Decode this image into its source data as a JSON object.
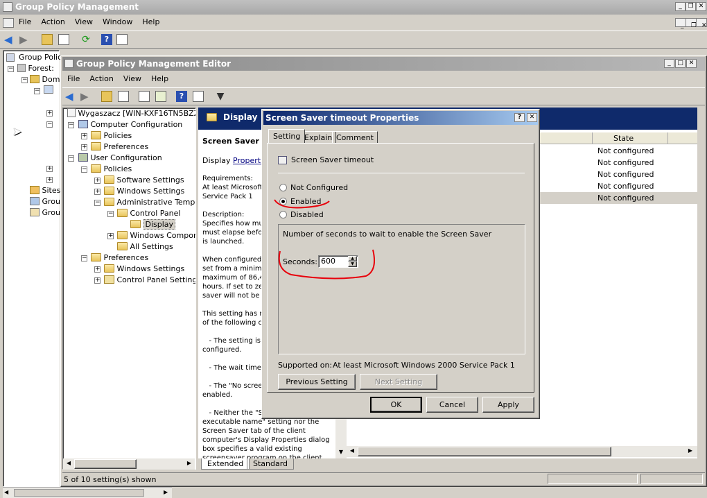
{
  "outer_window": {
    "title": "Group Policy Management",
    "menu": [
      "File",
      "Action",
      "View",
      "Window",
      "Help"
    ],
    "tree": [
      "Group Polic",
      "Forest:",
      "Dom",
      "Sites",
      "Grou",
      "Grou"
    ]
  },
  "editor": {
    "title": "Group Policy Management Editor",
    "menu": [
      "File",
      "Action",
      "View",
      "Help"
    ],
    "tree": {
      "root": "Wygaszacz [WIN-KXF16TN5BZZ.cc",
      "computer_configuration": "Computer Configuration",
      "policies": "Policies",
      "preferences": "Preferences",
      "user_configuration": "User Configuration",
      "user_policies": "Policies",
      "software_settings": "Software Settings",
      "windows_settings": "Windows Settings",
      "administrative_templates": "Administrative Templat",
      "control_panel": "Control Panel",
      "display": "Display",
      "windows_components": "Windows Compone",
      "all_settings": "All Settings",
      "user_preferences": "Preferences",
      "pref_windows_settings": "Windows Settings",
      "control_panel_settings": "Control Panel Settings"
    },
    "header": "Display",
    "desc": {
      "title": "Screen Saver t",
      "display_prefix": "Display",
      "properties_link": "Properties",
      "body_lines": [
        "Requirements:",
        "At least Microsoft",
        "Service Pack 1",
        "",
        "Description:",
        "Specifies how muc",
        "must elapse befor",
        "is launched.",
        "",
        "When configured,",
        "set from a minimu",
        "maximum of 86,40",
        "hours. If set to ze",
        "saver will not be s",
        "",
        "This setting has n",
        "of the following ci",
        "",
        "   - The setting is",
        "configured.",
        "",
        "   - The wait time",
        "",
        "   - The \"No scree",
        "enabled.",
        "",
        "   - Neither the \"S",
        "executable name\" setting nor the",
        "Screen Saver tab of the client",
        "computer's Display Properties dialog",
        "box specifies a valid existing",
        "screensaver program on the client"
      ]
    },
    "list": {
      "state_header": "State",
      "rows": [
        "Not configured",
        "Not configured",
        "Not configured",
        "Not configured",
        "Not configured"
      ]
    },
    "tabs": [
      "Extended",
      "Standard"
    ],
    "status": "5 of 10 setting(s) shown"
  },
  "dialog": {
    "title": "Screen Saver timeout Properties",
    "help_btn": "?",
    "close_btn": "✕",
    "tabs": [
      "Setting",
      "Explain",
      "Comment"
    ],
    "policy_name": "Screen Saver timeout",
    "options": [
      "Not Configured",
      "Enabled",
      "Disabled"
    ],
    "selected": "Enabled",
    "options_caption": "Number of seconds to wait to enable the Screen Saver",
    "seconds_label": "Seconds:",
    "seconds_value": "600",
    "supported_label": "Supported on:",
    "supported_value": "At least Microsoft Windows 2000 Service Pack 1",
    "previous_setting": "Previous Setting",
    "next_setting": "Next Setting",
    "ok": "OK",
    "cancel": "Cancel",
    "apply": "Apply"
  },
  "colors": {
    "annotation_red": "#e8000b",
    "dialog_title_start": "#0a246a",
    "dialog_title_end": "#a6caf0",
    "detail_header": "#0f2a6b"
  }
}
